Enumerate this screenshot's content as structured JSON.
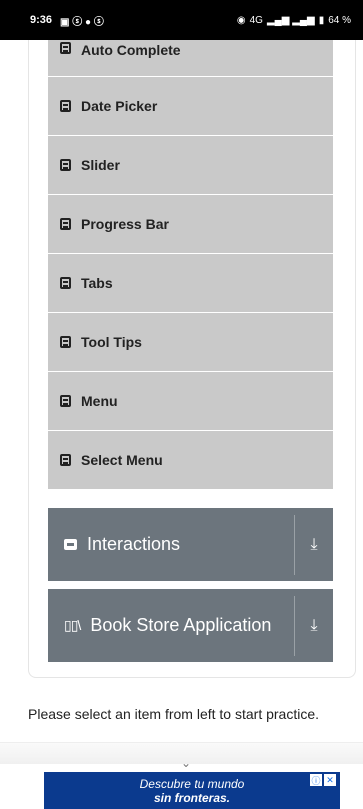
{
  "status_bar": {
    "time": "9:36",
    "battery": "64 %",
    "network": "4G"
  },
  "menu": {
    "items": [
      {
        "label": "Auto Complete"
      },
      {
        "label": "Date Picker"
      },
      {
        "label": "Slider"
      },
      {
        "label": "Progress Bar"
      },
      {
        "label": "Tabs"
      },
      {
        "label": "Tool Tips"
      },
      {
        "label": "Menu"
      },
      {
        "label": "Select Menu"
      }
    ]
  },
  "groups": {
    "interactions": {
      "label": "Interactions"
    },
    "book_store": {
      "label": "Book Store Application"
    }
  },
  "hint": "Please select an item from left to start practice.",
  "ad": {
    "line1": "Descubre tu mundo",
    "line2": "sin fronteras."
  },
  "colors": {
    "menu_bg": "#c9c9c9",
    "group_bg": "#6c757d",
    "ad_bg": "#0b3a8e"
  }
}
